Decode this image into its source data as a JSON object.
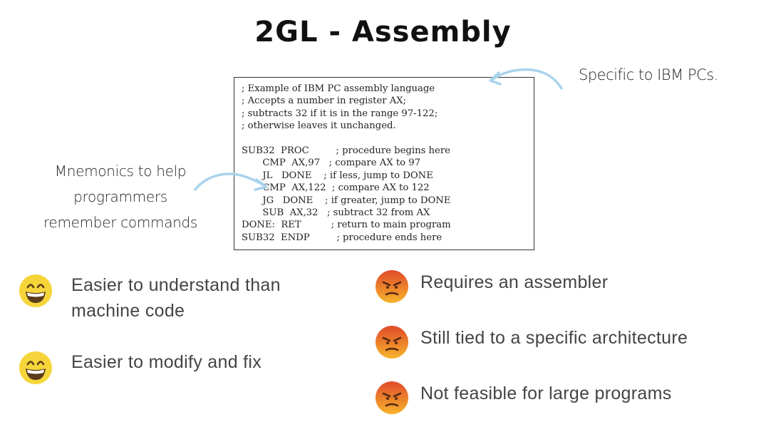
{
  "title": "2GL - Assembly",
  "code_lines": [
    "; Example of IBM PC assembly language",
    "; Accepts a number in register AX;",
    "; subtracts 32 if it is in the range 97-122;",
    "; otherwise leaves it unchanged.",
    "",
    "SUB32  PROC         ; procedure begins here",
    "       CMP  AX,97   ; compare AX to 97",
    "       JL   DONE    ; if less, jump to DONE",
    "       CMP  AX,122  ; compare AX to 122",
    "       JG   DONE    ; if greater, jump to DONE",
    "       SUB  AX,32   ; subtract 32 from AX",
    "DONE:  RET          ; return to main program",
    "SUB32  ENDP         ; procedure ends here"
  ],
  "annotations": {
    "right": "Specific to IBM PCs.",
    "left_lines": [
      "Mnemonics to help",
      "programmers",
      "remember commands"
    ]
  },
  "pros": [
    {
      "lines": [
        "Easier to understand than",
        "machine code"
      ],
      "icon": "grinning-face-icon"
    },
    {
      "lines": [
        "Easier to modify and fix"
      ],
      "icon": "grinning-face-icon"
    }
  ],
  "cons": [
    {
      "text": "Requires an assembler",
      "icon": "angry-face-icon"
    },
    {
      "text": "Still tied to a specific architecture",
      "icon": "angry-face-icon"
    },
    {
      "text": "Not feasible for large programs",
      "icon": "angry-face-icon"
    }
  ],
  "colors": {
    "arrow": "#a9d3ec",
    "happy_face": "#f6d53a",
    "angry_top": "#e04a2a",
    "angry_bottom": "#f7b42c"
  }
}
